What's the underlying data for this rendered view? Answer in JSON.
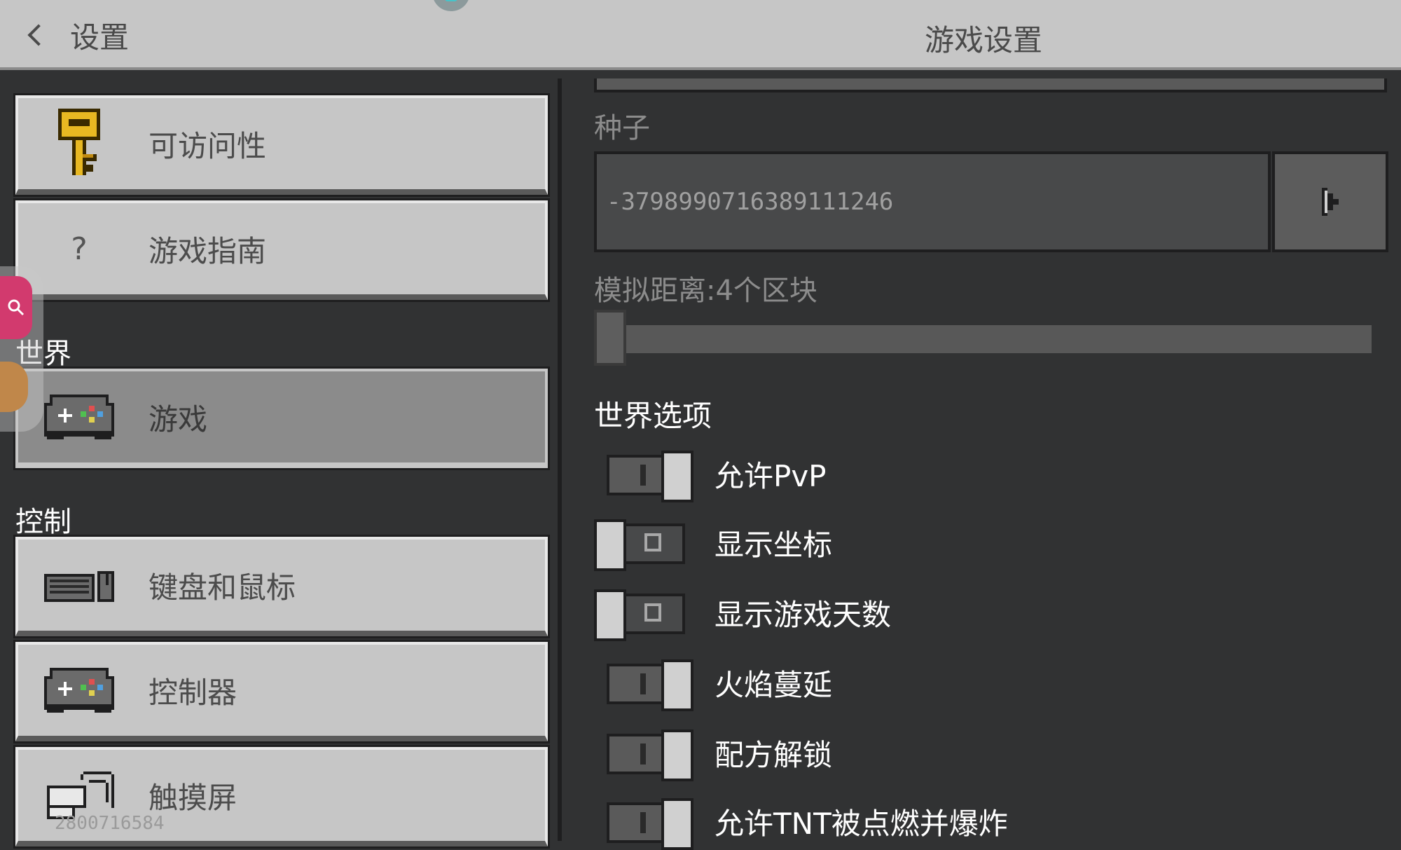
{
  "header": {
    "back_label": "设置",
    "title": "游戏设置"
  },
  "sidebar": {
    "items_top": [
      {
        "label": "可访问性",
        "icon": "key-icon"
      },
      {
        "label": "游戏指南",
        "icon": "question-icon",
        "glyph": "?"
      }
    ],
    "section_world": "世界",
    "world_item": {
      "label": "游戏",
      "icon": "gamepad-icon",
      "active": true
    },
    "section_controls": "控制",
    "control_items": [
      {
        "label": "键盘和鼠标",
        "icon": "keyboard-mouse-icon"
      },
      {
        "label": "控制器",
        "icon": "gamepad-icon"
      },
      {
        "label": "触摸屏",
        "icon": "touch-icon"
      }
    ],
    "watermark": "2800716584"
  },
  "main": {
    "seed_label": "种子",
    "seed_value": "-3798990716389111246",
    "sim_distance_label": "模拟距离:4个区块",
    "sim_distance_value": 4,
    "world_options_title": "世界选项",
    "toggles": [
      {
        "label": "允许PvP",
        "on": true
      },
      {
        "label": "显示坐标",
        "on": false
      },
      {
        "label": "显示游戏天数",
        "on": false
      },
      {
        "label": "火焰蔓延",
        "on": true
      },
      {
        "label": "配方解锁",
        "on": true
      },
      {
        "label": "允许TNT被点燃并爆炸",
        "on": true
      }
    ]
  },
  "colors": {
    "background": "#313233",
    "header": "#c6c6c6",
    "button": "#c6c6c6",
    "button_active": "#8b8b8b",
    "key_gold": "#e8b822"
  }
}
